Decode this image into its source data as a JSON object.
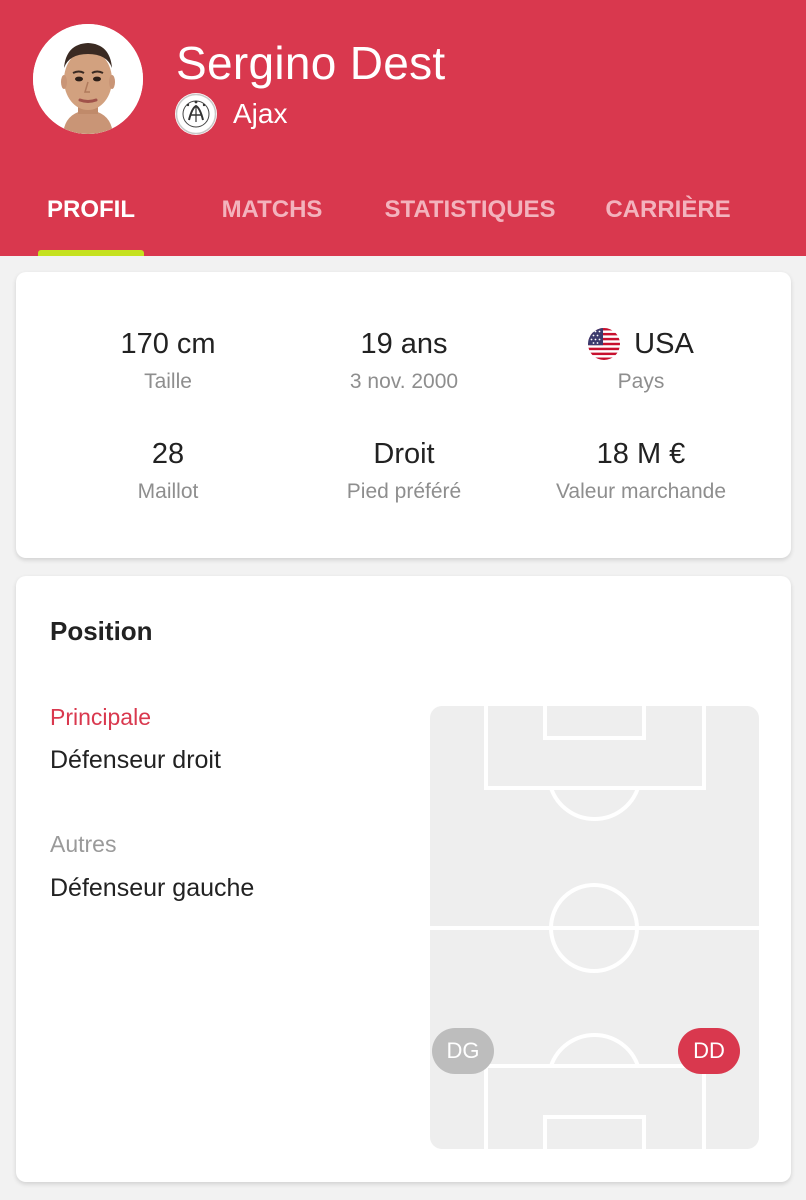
{
  "colors": {
    "accent": "#d9384e",
    "tab_indicator": "#c5e11f",
    "background": "#f2f2f2",
    "pitch": "#eeeeee"
  },
  "player": {
    "name": "Sergino Dest",
    "team": "Ajax",
    "avatar_icon": "player-portrait",
    "team_logo_icon": "ajax-club-logo"
  },
  "tabs": [
    {
      "label": "PROFIL",
      "active": true
    },
    {
      "label": "MATCHS",
      "active": false
    },
    {
      "label": "STATISTIQUES",
      "active": false
    },
    {
      "label": "CARRIÈRE",
      "active": false
    }
  ],
  "info": {
    "height": {
      "value": "170 cm",
      "label": "Taille"
    },
    "age": {
      "value": "19 ans",
      "label": "3 nov. 2000"
    },
    "country": {
      "value": "USA",
      "label": "Pays",
      "flag_icon": "usa-flag"
    },
    "shirt": {
      "value": "28",
      "label": "Maillot"
    },
    "foot": {
      "value": "Droit",
      "label": "Pied préféré"
    },
    "market_value": {
      "value": "18 M €",
      "label": "Valeur marchande"
    }
  },
  "position": {
    "title": "Position",
    "main_label": "Principale",
    "main_value": "Défenseur droit",
    "other_label": "Autres",
    "other_value": "Défenseur gauche",
    "badges": [
      {
        "code": "DG",
        "kind": "other"
      },
      {
        "code": "DD",
        "kind": "main"
      }
    ]
  }
}
